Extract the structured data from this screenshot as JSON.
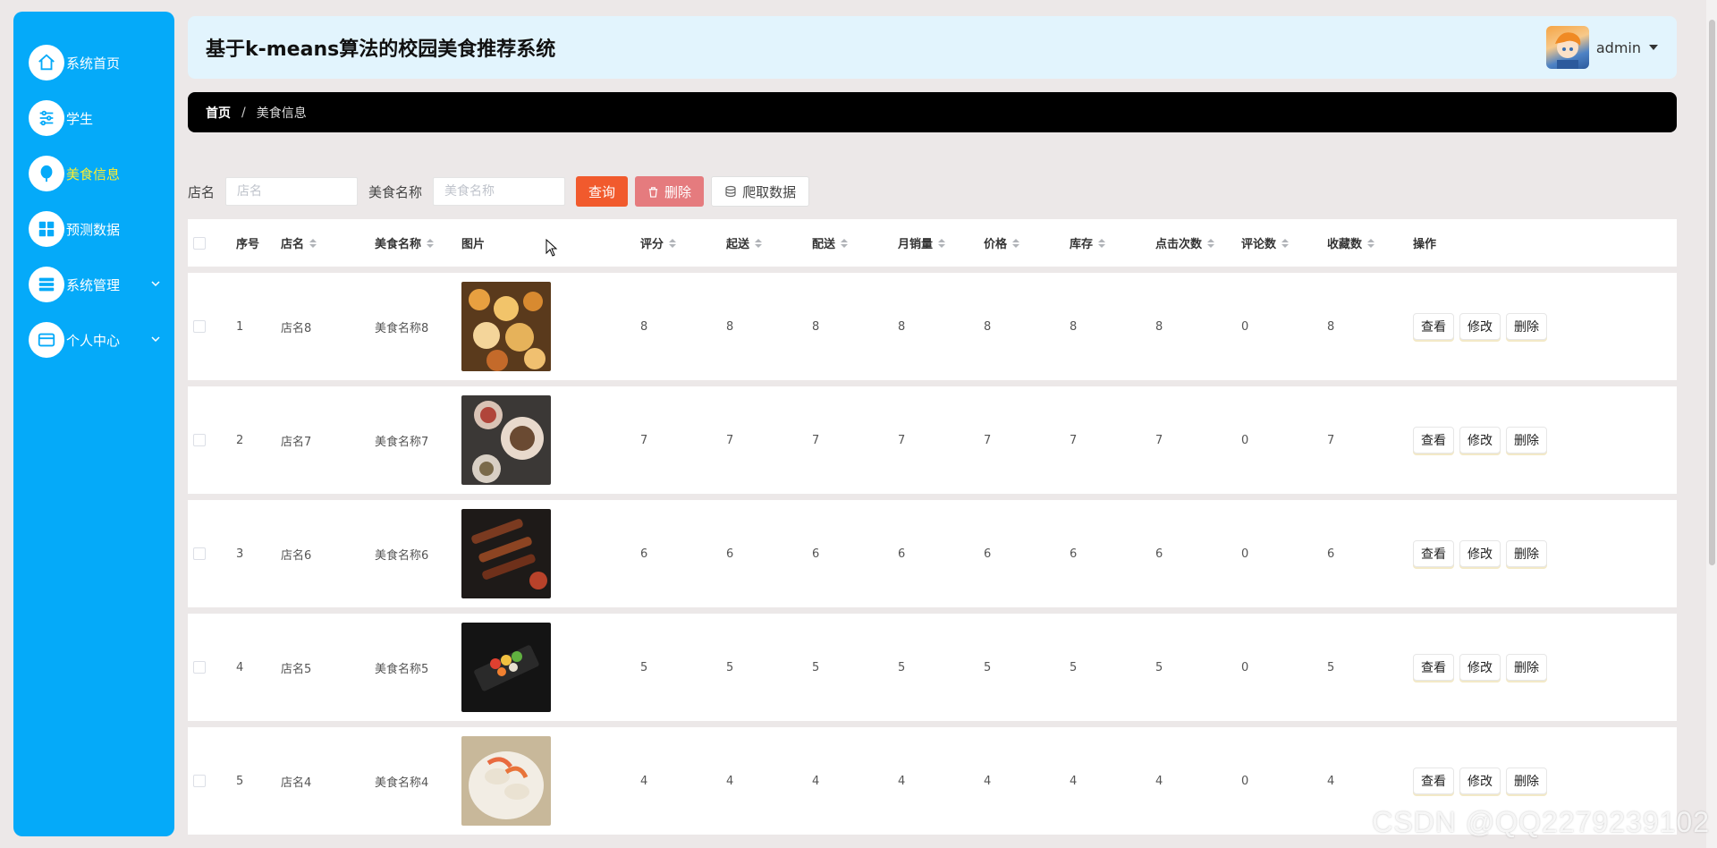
{
  "sidebar": {
    "items": [
      {
        "label": "系统首页",
        "icon": "home-icon",
        "active": false,
        "expandable": false
      },
      {
        "label": "学生",
        "icon": "sliders-icon",
        "active": false,
        "expandable": false
      },
      {
        "label": "美食信息",
        "icon": "balloon-icon",
        "active": true,
        "expandable": false
      },
      {
        "label": "预测数据",
        "icon": "grid-icon",
        "active": false,
        "expandable": false
      },
      {
        "label": "系统管理",
        "icon": "list-icon",
        "active": false,
        "expandable": true
      },
      {
        "label": "个人中心",
        "icon": "card-icon",
        "active": false,
        "expandable": true
      }
    ]
  },
  "header": {
    "title": "基于k-means算法的校园美食推荐系统",
    "username": "admin"
  },
  "breadcrumb": {
    "home": "首页",
    "separator": "/",
    "current": "美食信息"
  },
  "search": {
    "shop_label": "店名",
    "shop_placeholder": "店名",
    "food_label": "美食名称",
    "food_placeholder": "美食名称",
    "query_button": "查询",
    "delete_button": "删除",
    "crawl_button": "爬取数据"
  },
  "table": {
    "columns": {
      "index": "序号",
      "shop": "店名",
      "food_name": "美食名称",
      "image": "图片",
      "rating": "评分",
      "min_order": "起送",
      "delivery": "配送",
      "monthly_sales": "月销量",
      "price": "价格",
      "stock": "库存",
      "clicks": "点击次数",
      "comments": "评论数",
      "favorites": "收藏数",
      "actions": "操作"
    },
    "action_labels": {
      "view": "查看",
      "edit": "修改",
      "delete": "删除"
    },
    "rows": [
      {
        "index": "1",
        "shop": "店名8",
        "food_name": "美食名称8",
        "rating": "8",
        "min_order": "8",
        "delivery": "8",
        "monthly_sales": "8",
        "price": "8",
        "stock": "8",
        "clicks": "8",
        "comments": "0",
        "favorites": "8"
      },
      {
        "index": "2",
        "shop": "店名7",
        "food_name": "美食名称7",
        "rating": "7",
        "min_order": "7",
        "delivery": "7",
        "monthly_sales": "7",
        "price": "7",
        "stock": "7",
        "clicks": "7",
        "comments": "0",
        "favorites": "7"
      },
      {
        "index": "3",
        "shop": "店名6",
        "food_name": "美食名称6",
        "rating": "6",
        "min_order": "6",
        "delivery": "6",
        "monthly_sales": "6",
        "price": "6",
        "stock": "6",
        "clicks": "6",
        "comments": "0",
        "favorites": "6"
      },
      {
        "index": "4",
        "shop": "店名5",
        "food_name": "美食名称5",
        "rating": "5",
        "min_order": "5",
        "delivery": "5",
        "monthly_sales": "5",
        "price": "5",
        "stock": "5",
        "clicks": "5",
        "comments": "0",
        "favorites": "5"
      },
      {
        "index": "5",
        "shop": "店名4",
        "food_name": "美食名称4",
        "rating": "4",
        "min_order": "4",
        "delivery": "4",
        "monthly_sales": "4",
        "price": "4",
        "stock": "4",
        "clicks": "4",
        "comments": "0",
        "favorites": "4"
      }
    ]
  },
  "watermark": "CSDN @QQ2279239102",
  "colors": {
    "sidebar": "#05aaf9",
    "active_label": "#ffee2e",
    "header_bg": "#e2f4fd",
    "query_button": "#f15a2d",
    "delete_button": "#e57b7e"
  }
}
